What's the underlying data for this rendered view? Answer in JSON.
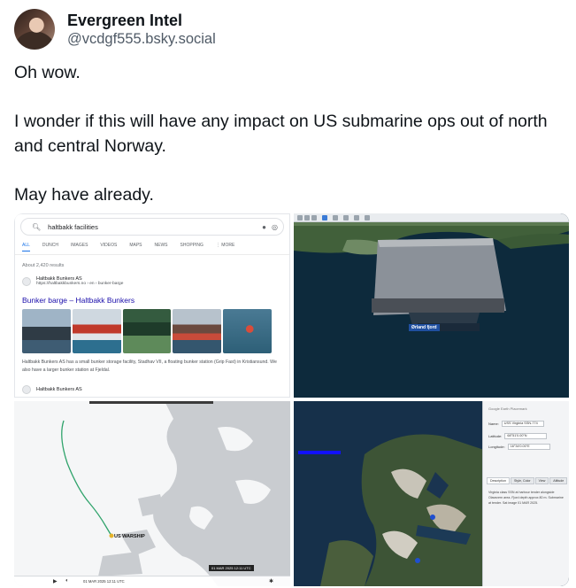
{
  "post": {
    "author": {
      "display_name": "Evergreen Intel",
      "handle": "@vcdgf555.bsky.social",
      "avatar_icon": "profile-photo"
    },
    "paragraphs": [
      "Oh wow.",
      "I wonder if this will have any impact on US submarine ops out of north and central Norway.",
      "May have already."
    ]
  },
  "images": {
    "search": {
      "query": "haltbakk facilities",
      "tabs": [
        "ALL",
        "DUNCH",
        "IMAGES",
        "VIDEOS",
        "MAPS",
        "NEWS",
        "SHOPPING",
        "⋮ MORE"
      ],
      "result_count": "About 2,420 results",
      "result1": {
        "site_name": "Haltbakk Bunkers AS",
        "url": "https://haltbakkbunkers.no › en › bunker-barge",
        "title": "Bunker barge – Haltbakk Bunkers",
        "description": "Haltbakk Bunkers AS has a small bunker storage facility, Stadhav VII, a floating bunker station (Grip Fast) in Kristiansund. We also have a larger bunker station at Fjeldal."
      },
      "result2": {
        "site_name": "Haltbakk Bunkers AS"
      }
    },
    "pier_map": {
      "ship_label": "Ørland fjord"
    },
    "track_map": {
      "warship_label": "US WARSHIP",
      "footer_time": "01 MAR 2025 12:11 UTC",
      "time_badge": "01 MAR 2025 12:11 UTC"
    },
    "satellite_map": {
      "panel_title": "Google Earth Placemark",
      "name_label": "Name:",
      "name_value": "USS Virginia SSN-774",
      "lat_label": "Latitude:",
      "lat_value": "68°51'0.00\"N",
      "lon_label": "Longitude:",
      "lon_value": "16°34'0.00\"E",
      "tabs": [
        "Description",
        "Style, Color",
        "View",
        "Altitude"
      ],
      "body": "Virginia class SSN at harbour tender alongside Olavsvern area. Fjord depth approx 80 m. Submarine at tender. Sat image 01 MAR 2025."
    }
  },
  "colors": {
    "text_primary": "#0f1419",
    "text_secondary": "#4f5a66",
    "link": "#1a0dab",
    "track_line": "#2fa36b"
  }
}
